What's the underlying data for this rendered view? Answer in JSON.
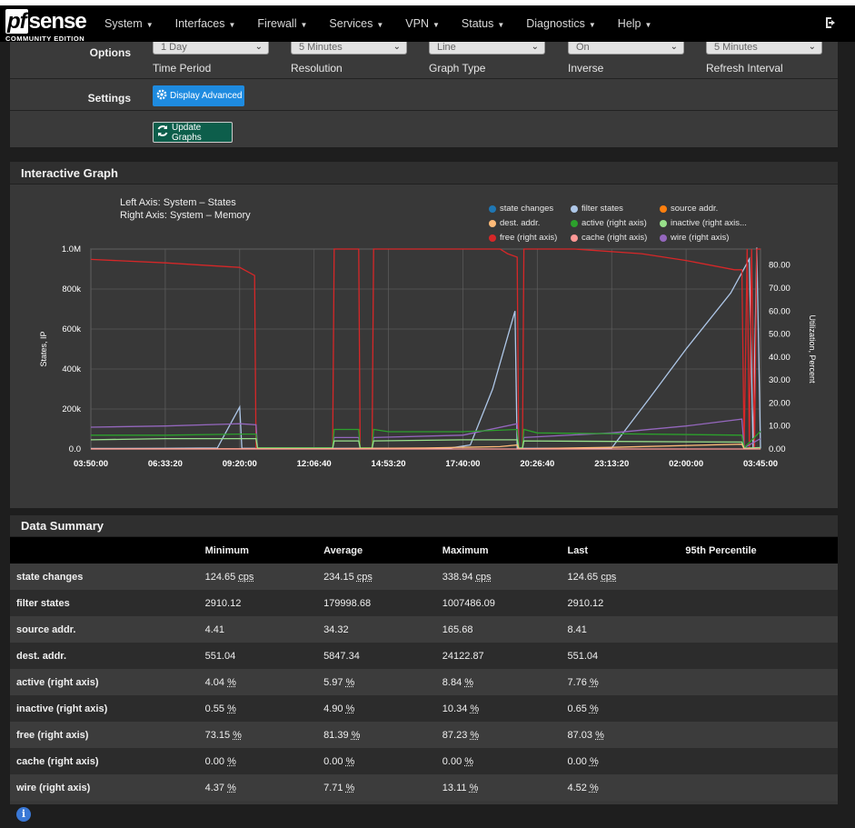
{
  "brand": {
    "logo_pf": "pf",
    "logo_sense": "sense",
    "edition": "COMMUNITY EDITION"
  },
  "nav": {
    "items": [
      {
        "label": "System"
      },
      {
        "label": "Interfaces"
      },
      {
        "label": "Firewall"
      },
      {
        "label": "Services"
      },
      {
        "label": "VPN"
      },
      {
        "label": "Status"
      },
      {
        "label": "Diagnostics"
      },
      {
        "label": "Help"
      }
    ]
  },
  "options": {
    "row_label": "Options",
    "settings_label": "Settings",
    "selects": [
      {
        "value": "1 Day",
        "label": "Time Period"
      },
      {
        "value": "5 Minutes",
        "label": "Resolution"
      },
      {
        "value": "Line",
        "label": "Graph Type"
      },
      {
        "value": "On",
        "label": "Inverse"
      },
      {
        "value": "5 Minutes",
        "label": "Refresh Interval"
      }
    ],
    "display_advanced": "Display Advanced",
    "update_graphs": "Update Graphs"
  },
  "graph": {
    "title": "Interactive Graph",
    "left_axis": "Left Axis: System – States",
    "right_axis": "Right Axis: System – Memory",
    "ylabel_left": "States, IP",
    "ylabel_right": "Utilization, Percent",
    "legend": [
      {
        "name": "state changes",
        "color": "#1f77b4"
      },
      {
        "name": "filter states",
        "color": "#aec7e8"
      },
      {
        "name": "source addr.",
        "color": "#ff7f0e"
      },
      {
        "name": "dest. addr.",
        "color": "#ffbb78"
      },
      {
        "name": "active (right axis)",
        "color": "#2ca02c"
      },
      {
        "name": "inactive (right axis...",
        "color": "#98df8a"
      },
      {
        "name": "free (right axis)",
        "color": "#d62728"
      },
      {
        "name": "cache (right axis)",
        "color": "#ff9896"
      },
      {
        "name": "wire (right axis)",
        "color": "#9467bd"
      }
    ]
  },
  "chart_data": {
    "type": "line",
    "x_ticks": [
      "03:50:00",
      "06:33:20",
      "09:20:00",
      "12:06:40",
      "14:53:20",
      "17:40:00",
      "20:26:40",
      "23:13:20",
      "02:00:00",
      "03:45:00"
    ],
    "y_left_ticks": [
      "0.0",
      "200k",
      "400k",
      "600k",
      "800k",
      "1.0M"
    ],
    "y_left_range": [
      0,
      1000000
    ],
    "y_right_ticks": [
      "0.00",
      "10.00",
      "20.00",
      "30.00",
      "40.00",
      "50.00",
      "60.00",
      "70.00",
      "80.00"
    ],
    "y_right_range": [
      0,
      87
    ],
    "grid": true,
    "legend_position": "top-right",
    "series": [
      {
        "name": "filter states",
        "axis": "left",
        "color": "#aec7e8",
        "points": [
          [
            0,
            2910
          ],
          [
            1,
            3000
          ],
          [
            1.7,
            5000
          ],
          [
            2,
            210000
          ],
          [
            2.03,
            3000
          ],
          [
            3.2,
            3000
          ],
          [
            3.8,
            3000
          ],
          [
            4.2,
            4000
          ],
          [
            4.8,
            3000
          ],
          [
            5.1,
            20000
          ],
          [
            5.4,
            300000
          ],
          [
            5.7,
            690000
          ],
          [
            5.73,
            3000
          ],
          [
            6.5,
            3000
          ],
          [
            7.0,
            5000
          ],
          [
            7.5,
            250000
          ],
          [
            8.0,
            500000
          ],
          [
            8.6,
            780000
          ],
          [
            8.85,
            950000
          ],
          [
            8.9,
            3000
          ],
          [
            8.95,
            1007486
          ],
          [
            9.0,
            2910
          ]
        ]
      },
      {
        "name": "free (right axis)",
        "axis": "right",
        "color": "#d62728",
        "points": [
          [
            0,
            82.5
          ],
          [
            1,
            81
          ],
          [
            2,
            79
          ],
          [
            2.2,
            75.5
          ],
          [
            2.22,
            0.2
          ],
          [
            3.25,
            0.2
          ],
          [
            3.27,
            87
          ],
          [
            3.6,
            87
          ],
          [
            3.62,
            0.2
          ],
          [
            3.78,
            0.2
          ],
          [
            3.8,
            87
          ],
          [
            5.5,
            87
          ],
          [
            5.6,
            85
          ],
          [
            5.73,
            83.5
          ],
          [
            5.75,
            0.2
          ],
          [
            5.8,
            0.2
          ],
          [
            5.82,
            87
          ],
          [
            6.5,
            87
          ],
          [
            7.4,
            85
          ],
          [
            8.0,
            82
          ],
          [
            8.65,
            78
          ],
          [
            8.75,
            78
          ],
          [
            8.78,
            0.2
          ],
          [
            8.82,
            87
          ],
          [
            8.85,
            0.2
          ],
          [
            8.88,
            87
          ],
          [
            8.92,
            0.2
          ],
          [
            8.95,
            87
          ],
          [
            9.0,
            87
          ]
        ]
      },
      {
        "name": "wire (right axis)",
        "axis": "right",
        "color": "#9467bd",
        "points": [
          [
            0,
            9.5
          ],
          [
            1,
            10
          ],
          [
            2,
            11
          ],
          [
            2.22,
            10.5
          ],
          [
            2.24,
            0.5
          ],
          [
            3.25,
            0.5
          ],
          [
            3.27,
            5
          ],
          [
            3.6,
            5
          ],
          [
            3.62,
            0.5
          ],
          [
            3.78,
            0.5
          ],
          [
            3.8,
            5
          ],
          [
            5,
            6
          ],
          [
            5.73,
            11
          ],
          [
            5.75,
            0.5
          ],
          [
            5.8,
            0.5
          ],
          [
            5.82,
            5
          ],
          [
            7,
            7
          ],
          [
            8,
            10
          ],
          [
            8.75,
            13
          ],
          [
            8.78,
            0.5
          ],
          [
            9.0,
            4.5
          ]
        ]
      },
      {
        "name": "active (right axis)",
        "axis": "right",
        "color": "#2ca02c",
        "points": [
          [
            0,
            6
          ],
          [
            1,
            6
          ],
          [
            2,
            6.5
          ],
          [
            2.22,
            6.5
          ],
          [
            2.24,
            0.5
          ],
          [
            3.25,
            0.5
          ],
          [
            3.27,
            8.5
          ],
          [
            3.6,
            8.5
          ],
          [
            3.62,
            0.5
          ],
          [
            3.78,
            0.5
          ],
          [
            3.8,
            8.5
          ],
          [
            4,
            7.5
          ],
          [
            5,
            7.5
          ],
          [
            5.73,
            8.5
          ],
          [
            5.75,
            0.5
          ],
          [
            5.8,
            0.5
          ],
          [
            5.82,
            8.5
          ],
          [
            6,
            7
          ],
          [
            8.75,
            6
          ],
          [
            8.78,
            0.5
          ],
          [
            9.0,
            7.7
          ]
        ]
      },
      {
        "name": "inactive (right axis)",
        "axis": "right",
        "color": "#98df8a",
        "points": [
          [
            0,
            4
          ],
          [
            1,
            4.5
          ],
          [
            2,
            4.5
          ],
          [
            2.22,
            4.5
          ],
          [
            2.24,
            0.3
          ],
          [
            3.25,
            0.3
          ],
          [
            3.27,
            3.5
          ],
          [
            3.6,
            3.5
          ],
          [
            3.62,
            0.3
          ],
          [
            3.78,
            0.3
          ],
          [
            3.8,
            3.5
          ],
          [
            5,
            4
          ],
          [
            5.73,
            4
          ],
          [
            5.75,
            0.3
          ],
          [
            5.8,
            0.3
          ],
          [
            5.82,
            3.5
          ],
          [
            8.75,
            3
          ],
          [
            8.78,
            0.3
          ],
          [
            9.0,
            0.65
          ]
        ]
      },
      {
        "name": "dest. addr.",
        "axis": "left",
        "color": "#ffbb78",
        "points": [
          [
            0,
            600
          ],
          [
            3,
            700
          ],
          [
            4.5,
            5000
          ],
          [
            5.5,
            12000
          ],
          [
            5.73,
            20000
          ],
          [
            5.75,
            600
          ],
          [
            7,
            8000
          ],
          [
            8.75,
            24000
          ],
          [
            8.78,
            600
          ],
          [
            9.0,
            551
          ]
        ]
      },
      {
        "name": "cache (right axis)",
        "axis": "right",
        "color": "#ff9896",
        "points": [
          [
            0,
            0
          ],
          [
            9.0,
            0
          ]
        ]
      }
    ]
  },
  "summary": {
    "title": "Data Summary",
    "headers": [
      "",
      "Minimum",
      "Average",
      "Maximum",
      "Last",
      "95th Percentile"
    ],
    "rows": [
      {
        "label": "state changes",
        "min": "124.65",
        "avg": "234.15",
        "max": "338.94",
        "last": "124.65",
        "unit": "cps"
      },
      {
        "label": "filter states",
        "min": "2910.12",
        "avg": "179998.68",
        "max": "1007486.09",
        "last": "2910.12",
        "unit": ""
      },
      {
        "label": "source addr.",
        "min": "4.41",
        "avg": "34.32",
        "max": "165.68",
        "last": "8.41",
        "unit": ""
      },
      {
        "label": "dest. addr.",
        "min": "551.04",
        "avg": "5847.34",
        "max": "24122.87",
        "last": "551.04",
        "unit": ""
      },
      {
        "label": "active (right axis)",
        "min": "4.04",
        "avg": "5.97",
        "max": "8.84",
        "last": "7.76",
        "unit": "%"
      },
      {
        "label": "inactive (right axis)",
        "min": "0.55",
        "avg": "4.90",
        "max": "10.34",
        "last": "0.65",
        "unit": "%"
      },
      {
        "label": "free (right axis)",
        "min": "73.15",
        "avg": "81.39",
        "max": "87.23",
        "last": "87.03",
        "unit": "%"
      },
      {
        "label": "cache (right axis)",
        "min": "0.00",
        "avg": "0.00",
        "max": "0.00",
        "last": "0.00",
        "unit": "%"
      },
      {
        "label": "wire (right axis)",
        "min": "4.37",
        "avg": "7.71",
        "max": "13.11",
        "last": "4.52",
        "unit": "%"
      }
    ]
  },
  "colors": {
    "accent_blue": "#1e8be0",
    "accent_green": "#0d5e4b",
    "navbar": "#000000"
  }
}
